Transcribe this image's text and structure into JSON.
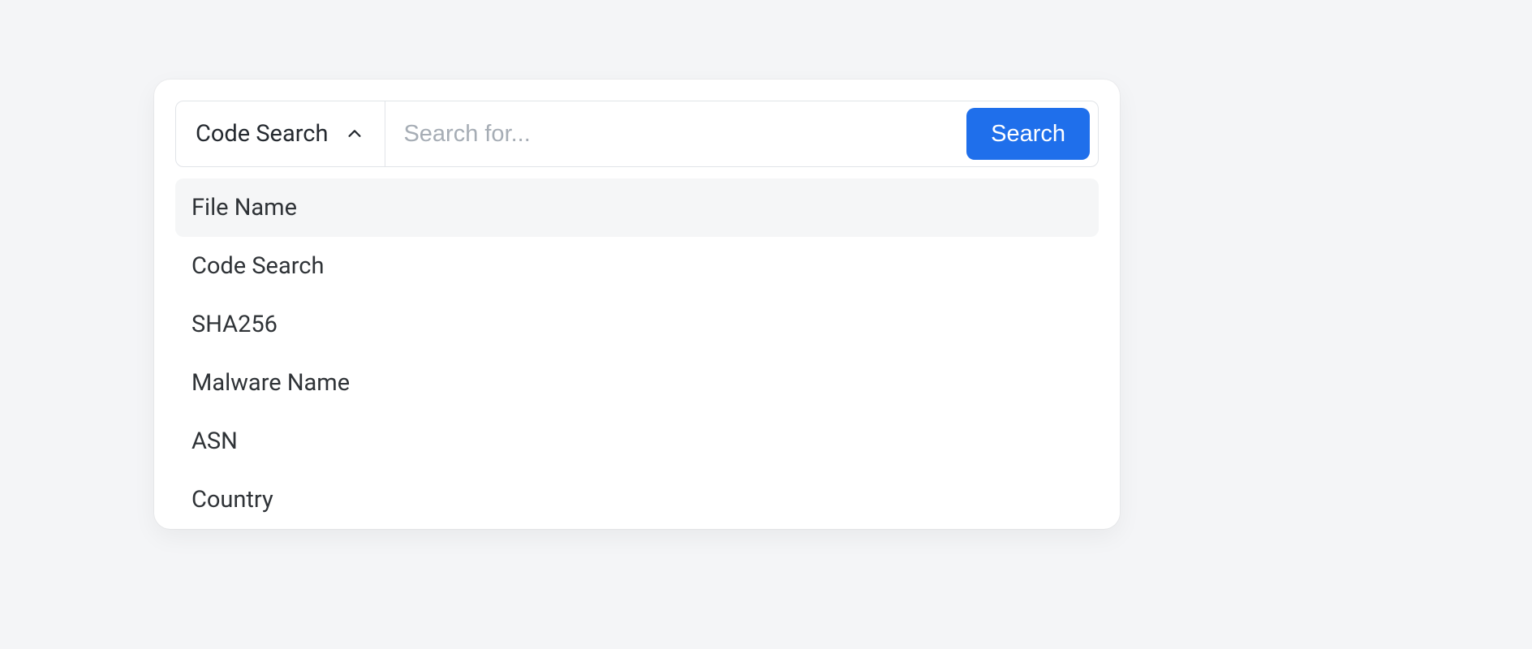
{
  "search": {
    "selected_filter": "Code Search",
    "placeholder": "Search for...",
    "value": "",
    "button_label": "Search"
  },
  "dropdown": {
    "open": true,
    "highlighted_index": 0,
    "options": [
      "File Name",
      "Code Search",
      "SHA256",
      "Malware Name",
      "ASN",
      "Country"
    ]
  }
}
